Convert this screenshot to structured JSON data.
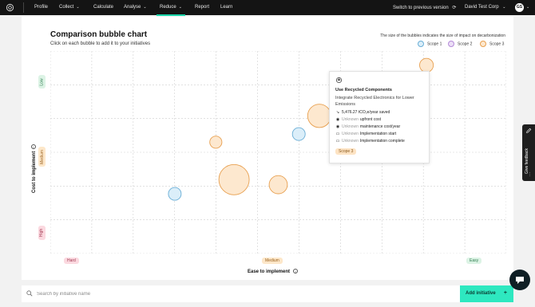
{
  "nav": {
    "items": [
      {
        "label": "Profile",
        "has_chevron": false,
        "active": false
      },
      {
        "label": "Collect",
        "has_chevron": true,
        "active": false
      },
      {
        "label": "Calculate",
        "has_chevron": false,
        "active": false
      },
      {
        "label": "Analyse",
        "has_chevron": true,
        "active": false
      },
      {
        "label": "Reduce",
        "has_chevron": true,
        "active": true
      },
      {
        "label": "Report",
        "has_chevron": false,
        "active": false
      },
      {
        "label": "Learn",
        "has_chevron": false,
        "active": false
      }
    ],
    "switch_version": "Switch to previous version",
    "company": "David Test Corp",
    "avatar_initials": "GS",
    "accent": "#18d5a8"
  },
  "chart": {
    "title": "Comparison bubble chart",
    "subtitle": "Click on each bubble to add it to your initiatives",
    "legend_note": "The size of the bubbles indicates the size of impact on decarbonization",
    "legend": [
      {
        "label": "Scope 1",
        "fill": "#dbeef9",
        "stroke": "#6aaed6"
      },
      {
        "label": "Scope 2",
        "fill": "#ecdff6",
        "stroke": "#b48ad8"
      },
      {
        "label": "Scope 3",
        "fill": "#fde8cf",
        "stroke": "#e8a050"
      }
    ],
    "ylabel": "Cost to implement",
    "xlabel": "Ease to implement",
    "y_levels": [
      {
        "label": "Low",
        "bg": "#dcf3e5",
        "fg": "#2f7d4f"
      },
      {
        "label": "Medium",
        "bg": "#fde7c9",
        "fg": "#9a6220"
      },
      {
        "label": "High",
        "bg": "#fbd9e0",
        "fg": "#a23a52"
      }
    ],
    "x_levels": [
      {
        "label": "Hard",
        "bg": "#fbd9e0",
        "fg": "#a23a52"
      },
      {
        "label": "Medium",
        "bg": "#fde7c9",
        "fg": "#9a6220"
      },
      {
        "label": "Easy",
        "bg": "#dcf3e5",
        "fg": "#2f7d4f"
      }
    ]
  },
  "chart_data": {
    "type": "scatter",
    "title": "Comparison bubble chart",
    "xlabel": "Ease to implement",
    "ylabel": "Cost to implement",
    "x_categories": [
      "Hard",
      "Medium",
      "Easy"
    ],
    "y_categories": [
      "Low",
      "Medium",
      "High"
    ],
    "bubbles": [
      {
        "x": 0.825,
        "y": 0.07,
        "size": 0.45,
        "scope": "Scope 3"
      },
      {
        "x": 0.59,
        "y": 0.32,
        "size": 0.77,
        "scope": "Scope 3"
      },
      {
        "x": 0.545,
        "y": 0.41,
        "size": 0.42,
        "scope": "Scope 1"
      },
      {
        "x": 0.363,
        "y": 0.45,
        "size": 0.4,
        "scope": "Scope 3"
      },
      {
        "x": 0.403,
        "y": 0.635,
        "size": 1.0,
        "scope": "Scope 3"
      },
      {
        "x": 0.5,
        "y": 0.66,
        "size": 0.6,
        "scope": "Scope 3"
      },
      {
        "x": 0.273,
        "y": 0.705,
        "size": 0.42,
        "scope": "Scope 1"
      }
    ]
  },
  "tooltip": {
    "title": "Use Recycled Components",
    "description": "Integrate Recycled Electronics for Lower Emissions",
    "savings": "5,476.27 tCO₂e/year saved",
    "rows": [
      {
        "muted": "Unknown",
        "text": "upfront cost"
      },
      {
        "muted": "Unknown",
        "text": "maintenance cost/year"
      },
      {
        "muted": "Unknown",
        "text": "Implementation start"
      },
      {
        "muted": "Unknown",
        "text": "Implementation complete"
      }
    ],
    "scope": "Scope 3"
  },
  "search": {
    "placeholder": "Search by initiative name",
    "add_label": "Add initiative",
    "add_plus": "+"
  },
  "feedback": {
    "label": "Give feedback",
    "dots": "⋮"
  }
}
